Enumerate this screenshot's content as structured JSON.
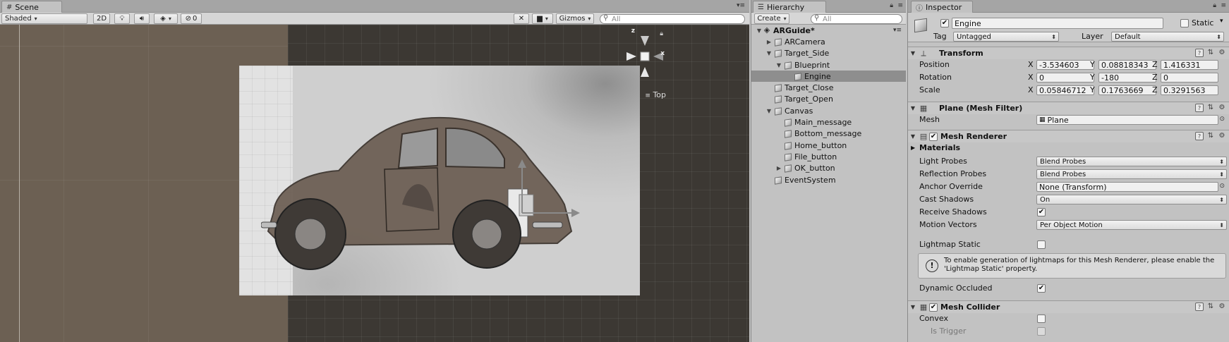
{
  "scene": {
    "tab_label": "Scene",
    "shading_mode": "Shaded",
    "mode_2d": "2D",
    "effects_count": "0",
    "gizmos_label": "Gizmos",
    "search_placeholder": "All",
    "view_label": "Top",
    "axes": {
      "z": "z",
      "x": "x"
    }
  },
  "hierarchy": {
    "tab_label": "Hierarchy",
    "create_label": "Create",
    "search_placeholder": "All",
    "items": [
      {
        "label": "ARGuide*",
        "depth": 0,
        "expanded": true,
        "has_children": true,
        "root": true
      },
      {
        "label": "ARCamera",
        "depth": 1,
        "expanded": false,
        "has_children": true
      },
      {
        "label": "Target_Side",
        "depth": 1,
        "expanded": true,
        "has_children": true
      },
      {
        "label": "Blueprint",
        "depth": 2,
        "expanded": true,
        "has_children": true
      },
      {
        "label": "Engine",
        "depth": 3,
        "expanded": false,
        "has_children": false,
        "selected": true
      },
      {
        "label": "Target_Close",
        "depth": 1,
        "expanded": false,
        "has_children": false
      },
      {
        "label": "Target_Open",
        "depth": 1,
        "expanded": false,
        "has_children": false
      },
      {
        "label": "Canvas",
        "depth": 1,
        "expanded": true,
        "has_children": true
      },
      {
        "label": "Main_message",
        "depth": 2,
        "expanded": false,
        "has_children": false
      },
      {
        "label": "Bottom_message",
        "depth": 2,
        "expanded": false,
        "has_children": false
      },
      {
        "label": "Home_button",
        "depth": 2,
        "expanded": false,
        "has_children": false
      },
      {
        "label": "File_button",
        "depth": 2,
        "expanded": false,
        "has_children": false
      },
      {
        "label": "OK_button",
        "depth": 2,
        "expanded": false,
        "has_children": true
      },
      {
        "label": "EventSystem",
        "depth": 1,
        "expanded": false,
        "has_children": false
      }
    ]
  },
  "inspector": {
    "tab_label": "Inspector",
    "object_name": "Engine",
    "static_label": "Static",
    "tag_label": "Tag",
    "tag_value": "Untagged",
    "layer_label": "Layer",
    "layer_value": "Default",
    "transform": {
      "title": "Transform",
      "position_label": "Position",
      "rotation_label": "Rotation",
      "scale_label": "Scale",
      "position": {
        "x": "-3.534603",
        "y": "0.08818343",
        "z": "1.416331"
      },
      "rotation": {
        "x": "0",
        "y": "-180",
        "z": "0"
      },
      "scale": {
        "x": "0.05846712",
        "y": "0.1763669",
        "z": "0.3291563"
      }
    },
    "mesh_filter": {
      "title": "Plane (Mesh Filter)",
      "mesh_label": "Mesh",
      "mesh_value": "Plane"
    },
    "mesh_renderer": {
      "title": "Mesh Renderer",
      "materials_label": "Materials",
      "light_probes_label": "Light Probes",
      "light_probes_value": "Blend Probes",
      "reflection_probes_label": "Reflection Probes",
      "reflection_probes_value": "Blend Probes",
      "anchor_override_label": "Anchor Override",
      "anchor_override_value": "None (Transform)",
      "cast_shadows_label": "Cast Shadows",
      "cast_shadows_value": "On",
      "receive_shadows_label": "Receive Shadows",
      "motion_vectors_label": "Motion Vectors",
      "motion_vectors_value": "Per Object Motion",
      "lightmap_static_label": "Lightmap Static",
      "help_text_1": "To enable generation of lightmaps for this Mesh Renderer, please enable the",
      "help_text_2": "'Lightmap Static' property.",
      "dynamic_occluded_label": "Dynamic Occluded"
    },
    "mesh_collider": {
      "title": "Mesh Collider",
      "convex_label": "Convex",
      "is_trigger_label": "Is Trigger"
    }
  },
  "colors": {
    "viewport_left": "#6c6053",
    "viewport_grid": "#3c3833",
    "selection": "#8e8e8e",
    "panel_bg": "#c2c2c2"
  }
}
